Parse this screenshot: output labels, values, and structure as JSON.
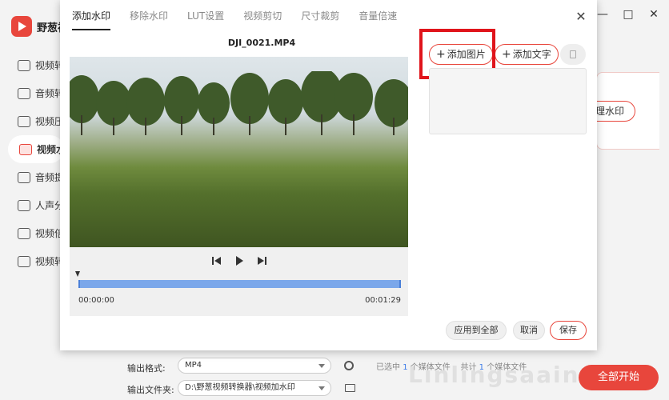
{
  "app": {
    "name": "野葱视",
    "sidebar": [
      {
        "label": "视频转",
        "icon": "video-convert-icon"
      },
      {
        "label": "音频转",
        "icon": "audio-convert-icon"
      },
      {
        "label": "视频压",
        "icon": "video-compress-icon"
      },
      {
        "label": "视频水",
        "icon": "video-watermark-icon",
        "active": true
      },
      {
        "label": "音频提",
        "icon": "audio-extract-icon"
      },
      {
        "label": "人声分",
        "icon": "voice-separate-icon"
      },
      {
        "label": "视频倍",
        "icon": "video-speed-icon"
      },
      {
        "label": "视频转",
        "icon": "video-gif-icon"
      }
    ],
    "right_panel_button": "理水印",
    "window_controls": [
      "—",
      "□",
      "✕"
    ]
  },
  "footer": {
    "output_format_label": "输出格式:",
    "output_format_value": "MP4",
    "output_folder_label": "输出文件夹:",
    "output_folder_value": "D:\\野葱视频转换器\\视频加水印",
    "selected_prefix": "已选中",
    "selected_count": "1",
    "selected_suffix": "个媒体文件",
    "total_prefix": "共计",
    "total_count": "1",
    "total_suffix": "个媒体文件",
    "start_button": "全部开始",
    "watermark": "Linlingsaaing"
  },
  "dialog": {
    "tabs": [
      {
        "label": "添加水印",
        "active": true
      },
      {
        "label": "移除水印"
      },
      {
        "label": "LUT设置"
      },
      {
        "label": "视频剪切"
      },
      {
        "label": "尺寸裁剪"
      },
      {
        "label": "音量倍速"
      }
    ],
    "close_icon": "✕",
    "video_title": "DJI_0021.MP4",
    "time_start": "00:00:00",
    "time_end": "00:01:29",
    "add_image_button": "添加图片",
    "add_text_button": "添加文字",
    "apply_all_button": "应用到全部",
    "cancel_button": "取消",
    "save_button": "保存"
  },
  "colors": {
    "accent": "#e8463c",
    "highlight_box": "#e0141b",
    "timeline": "#7ba7ea",
    "link_number": "#3c7be8"
  }
}
